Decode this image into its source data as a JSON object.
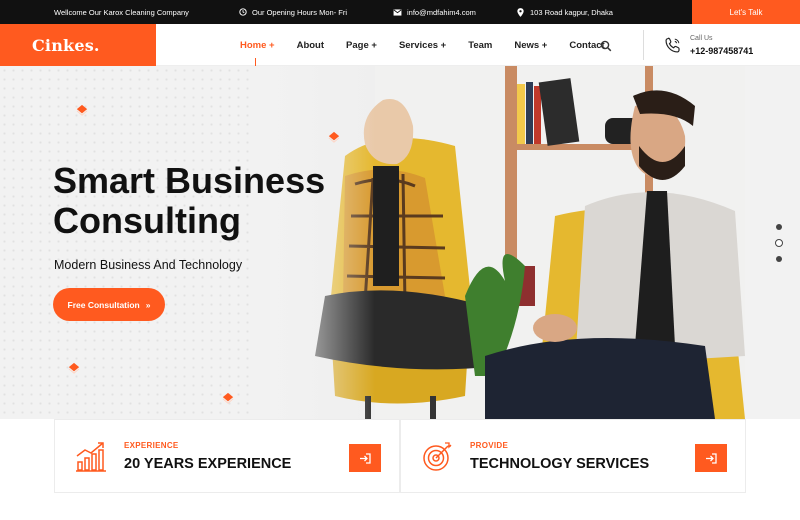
{
  "topbar": {
    "welcome": "Wellcome Our Karox Cleaning Company",
    "hours": "Our Opening Hours Mon- Fri",
    "email": "info@mdfahim4.com",
    "address": "103 Road kagpur, Dhaka",
    "cta": "Let's Talk",
    "icons": [
      "clock-icon",
      "mail-icon",
      "location-pin-icon"
    ]
  },
  "header": {
    "logo": "Cinkes.",
    "nav": [
      "Home +",
      "About",
      "Page +",
      "Services +",
      "Team",
      "News +",
      "Contact"
    ],
    "active_nav": "Home +",
    "call_label": "Call Us",
    "call_number": "+12-987458741"
  },
  "hero": {
    "title_line1": "Smart Business",
    "title_line2": "Consulting",
    "subtitle": "Modern Business And Technology",
    "button_label": "Free Consultation",
    "button_arrow": "»",
    "slides_total": 3,
    "active_slide": 2
  },
  "cards": [
    {
      "kicker": "EXPERIENCE",
      "title": "20 YEARS EXPERIENCE",
      "icon": "growth-chart-icon"
    },
    {
      "kicker": "PROVIDE",
      "title": "TECHNOLOGY SERVICES",
      "icon": "target-icon"
    }
  ],
  "colors": {
    "accent": "#ff5a1f",
    "dark": "#111111",
    "hero_bg": "#f2f2f2"
  }
}
